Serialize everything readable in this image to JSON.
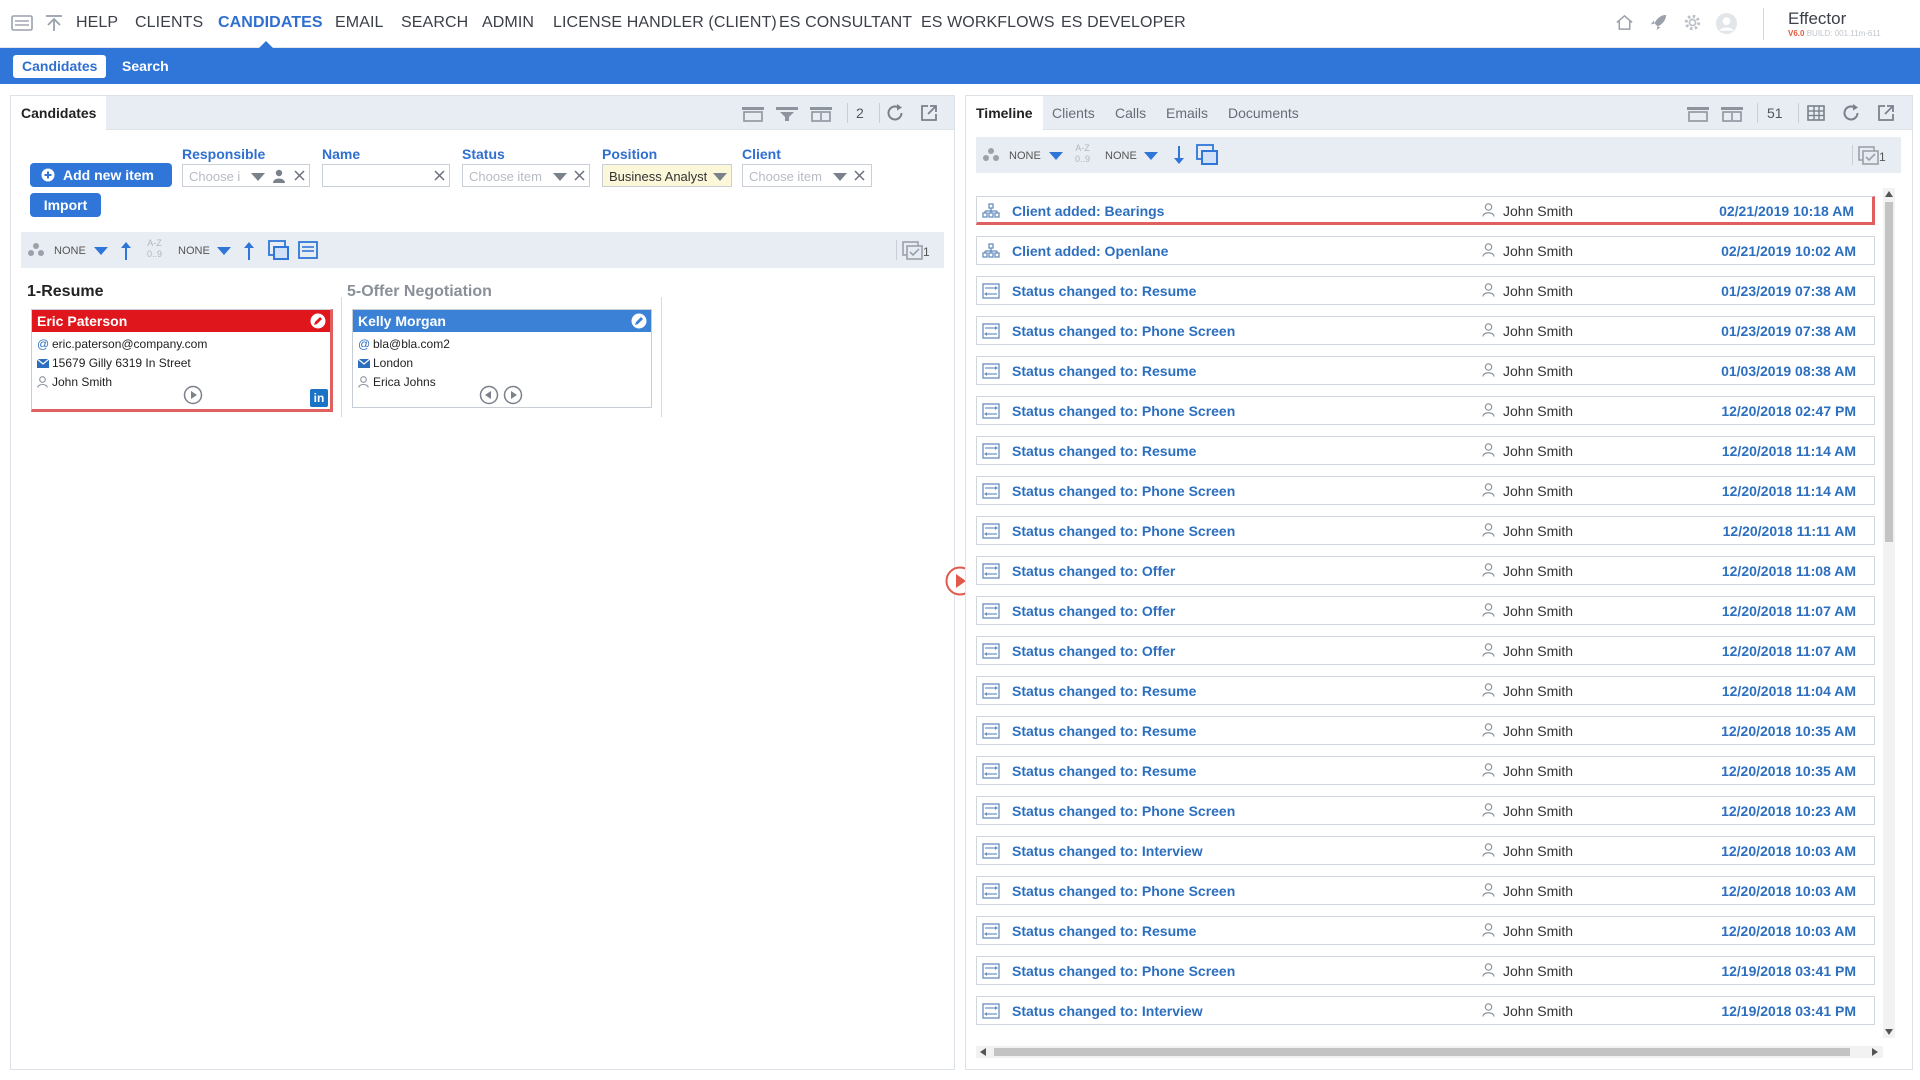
{
  "nav": {
    "items": [
      "HELP",
      "CLIENTS",
      "CANDIDATES",
      "EMAIL",
      "SEARCH",
      "ADMIN",
      "LICENSE HANDLER (CLIENT)",
      "ES CONSULTANT",
      "ES WORKFLOWS",
      "ES DEVELOPER"
    ],
    "active": "CANDIDATES",
    "brand": "Effector",
    "version_label": "V6.0",
    "build_label": "BUILD: 001.11m-611"
  },
  "subnav": {
    "tabs": [
      "Candidates",
      "Search"
    ],
    "active": "Candidates"
  },
  "left_panel": {
    "tab": "Candidates",
    "count": "2",
    "add_button": "Add new item",
    "import_button": "Import",
    "filters": {
      "responsible": {
        "label": "Responsible",
        "placeholder": "Choose i"
      },
      "name": {
        "label": "Name",
        "value": ""
      },
      "status": {
        "label": "Status",
        "placeholder": "Choose item"
      },
      "position": {
        "label": "Position",
        "value": "Business Analyst"
      },
      "client": {
        "label": "Client",
        "placeholder": "Choose item"
      }
    },
    "sortbar": {
      "group": "NONE",
      "sort": "NONE",
      "az_label": "A-Z",
      "num_label": "0..9",
      "count": "1"
    },
    "columns": [
      {
        "title": "1-Resume",
        "cards": [
          {
            "name": "Eric Paterson",
            "email": "eric.paterson@company.com",
            "address": "15679 Gilly 6319 In Street",
            "responsible": "John Smith",
            "linkedin_label": "in"
          }
        ]
      },
      {
        "title": "5-Offer Negotiation",
        "cards": [
          {
            "name": "Kelly Morgan",
            "email": "bla@bla.com2",
            "address": "London",
            "responsible": "Erica Johns"
          }
        ]
      }
    ]
  },
  "right_panel": {
    "tabs": [
      "Timeline",
      "Clients",
      "Calls",
      "Emails",
      "Documents"
    ],
    "active_tab": "Timeline",
    "count": "51",
    "sortbar": {
      "group": "NONE",
      "sort": "NONE",
      "az_label": "A-Z",
      "num_label": "0..9",
      "count": "1"
    },
    "timeline": [
      {
        "title": "Client added: Bearings",
        "user": "John Smith",
        "date": "02/21/2019 10:18 AM",
        "type": "client"
      },
      {
        "title": "Client added: Openlane",
        "user": "John Smith",
        "date": "02/21/2019 10:02 AM",
        "type": "client"
      },
      {
        "title": "Status changed to: Resume",
        "user": "John Smith",
        "date": "01/23/2019 07:38 AM",
        "type": "status"
      },
      {
        "title": "Status changed to: Phone Screen",
        "user": "John Smith",
        "date": "01/23/2019 07:38 AM",
        "type": "status"
      },
      {
        "title": "Status changed to: Resume",
        "user": "John Smith",
        "date": "01/03/2019 08:38 AM",
        "type": "status"
      },
      {
        "title": "Status changed to: Phone Screen",
        "user": "John Smith",
        "date": "12/20/2018 02:47 PM",
        "type": "status"
      },
      {
        "title": "Status changed to: Resume",
        "user": "John Smith",
        "date": "12/20/2018 11:14 AM",
        "type": "status"
      },
      {
        "title": "Status changed to: Phone Screen",
        "user": "John Smith",
        "date": "12/20/2018 11:14 AM",
        "type": "status"
      },
      {
        "title": "Status changed to: Phone Screen",
        "user": "John Smith",
        "date": "12/20/2018 11:11 AM",
        "type": "status"
      },
      {
        "title": "Status changed to: Offer",
        "user": "John Smith",
        "date": "12/20/2018 11:08 AM",
        "type": "status"
      },
      {
        "title": "Status changed to: Offer",
        "user": "John Smith",
        "date": "12/20/2018 11:07 AM",
        "type": "status"
      },
      {
        "title": "Status changed to: Offer",
        "user": "John Smith",
        "date": "12/20/2018 11:07 AM",
        "type": "status"
      },
      {
        "title": "Status changed to: Resume",
        "user": "John Smith",
        "date": "12/20/2018 11:04 AM",
        "type": "status"
      },
      {
        "title": "Status changed to: Resume",
        "user": "John Smith",
        "date": "12/20/2018 10:35 AM",
        "type": "status"
      },
      {
        "title": "Status changed to: Resume",
        "user": "John Smith",
        "date": "12/20/2018 10:35 AM",
        "type": "status"
      },
      {
        "title": "Status changed to: Phone Screen",
        "user": "John Smith",
        "date": "12/20/2018 10:23 AM",
        "type": "status"
      },
      {
        "title": "Status changed to: Interview",
        "user": "John Smith",
        "date": "12/20/2018 10:03 AM",
        "type": "status"
      },
      {
        "title": "Status changed to: Phone Screen",
        "user": "John Smith",
        "date": "12/20/2018 10:03 AM",
        "type": "status"
      },
      {
        "title": "Status changed to: Resume",
        "user": "John Smith",
        "date": "12/20/2018 10:03 AM",
        "type": "status"
      },
      {
        "title": "Status changed to: Phone Screen",
        "user": "John Smith",
        "date": "12/19/2018 03:41 PM",
        "type": "status"
      },
      {
        "title": "Status changed to: Interview",
        "user": "John Smith",
        "date": "12/19/2018 03:41 PM",
        "type": "status"
      }
    ]
  },
  "colors": {
    "primary": "#2f76d8",
    "link": "#2d6fbf",
    "card_red": "#e0161d",
    "card_blue": "#3b82d6",
    "highlight": "#e06060",
    "linkedin": "#1a73c4"
  },
  "icons": [
    "menu-icon",
    "upload-icon",
    "home-icon",
    "rocket-icon",
    "gear-icon",
    "avatar-icon",
    "plus-circle-icon",
    "refresh-icon",
    "external-link-icon",
    "filter-icon",
    "person-icon",
    "mail-icon",
    "at-icon",
    "play-circle-icon",
    "linkedin-icon",
    "edit-icon",
    "status-change-icon",
    "org-chart-icon",
    "table-icon",
    "collapse-arrow-icon"
  ]
}
